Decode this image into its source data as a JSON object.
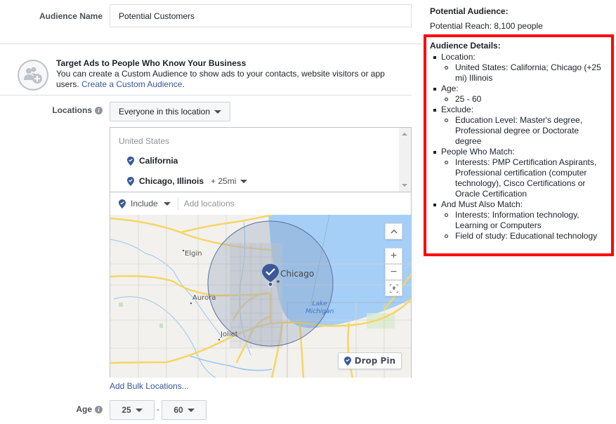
{
  "audience_name": {
    "label": "Audience Name",
    "value": "Potential Customers"
  },
  "promo": {
    "title": "Target Ads to People Who Know Your Business",
    "text": "You can create a Custom Audience to show ads to your contacts, website visitors or app users. ",
    "link": "Create a Custom Audience",
    "suffix": ".",
    "icon": "add-people-icon"
  },
  "locations": {
    "label": "Locations",
    "info_icon": "i",
    "scope_dropdown": "Everyone in this location",
    "country": "United States",
    "items": [
      {
        "name": "California",
        "radius": null
      },
      {
        "name": "Chicago, Illinois",
        "radius": "+ 25mi"
      }
    ],
    "include_label": "Include",
    "add_placeholder": "Add locations",
    "bulk_link": "Add Bulk Locations..."
  },
  "map": {
    "labels": {
      "elgin": "Elgin",
      "aurora": "Aurora",
      "joliet": "Joliet",
      "chicago": "Chicago",
      "lake_line1": "Lake",
      "lake_line2": "Michigan"
    },
    "controls": {
      "collapse": "^",
      "zoom_in": "+",
      "zoom_out": "−",
      "fit": "fit-icon"
    },
    "drop_pin": "Drop Pin",
    "colors": {
      "water": "#a5cff7",
      "land": "#f2f1ee",
      "highway": "#f7d562",
      "radius_fill": "#7f8fb5",
      "pin": "#3b5998"
    }
  },
  "age": {
    "label": "Age",
    "min": "25",
    "separator": "-",
    "max": "60"
  },
  "potential_audience": {
    "title": "Potential Audience:",
    "reach": "Potential Reach: 8,100 people"
  },
  "audience_details": {
    "title": "Audience Details:",
    "sections": [
      {
        "label": "Location:",
        "items": [
          "United States: California; Chicago (+25 mi) Illinois"
        ]
      },
      {
        "label": "Age:",
        "items": [
          "25 - 60"
        ]
      },
      {
        "label": "Exclude:",
        "items": [
          "Education Level: Master's degree, Professional degree or Doctorate degree"
        ]
      },
      {
        "label": "People Who Match:",
        "items": [
          "Interests: PMP Certification Aspirants, Professional certification (computer technology), Cisco Certifications or Oracle Certification"
        ]
      },
      {
        "label": "And Must Also Match:",
        "items": [
          "Interests: Information technology, Learning or Computers",
          "Field of study: Educational technology"
        ]
      }
    ],
    "highlight_color": "#ff0000"
  }
}
